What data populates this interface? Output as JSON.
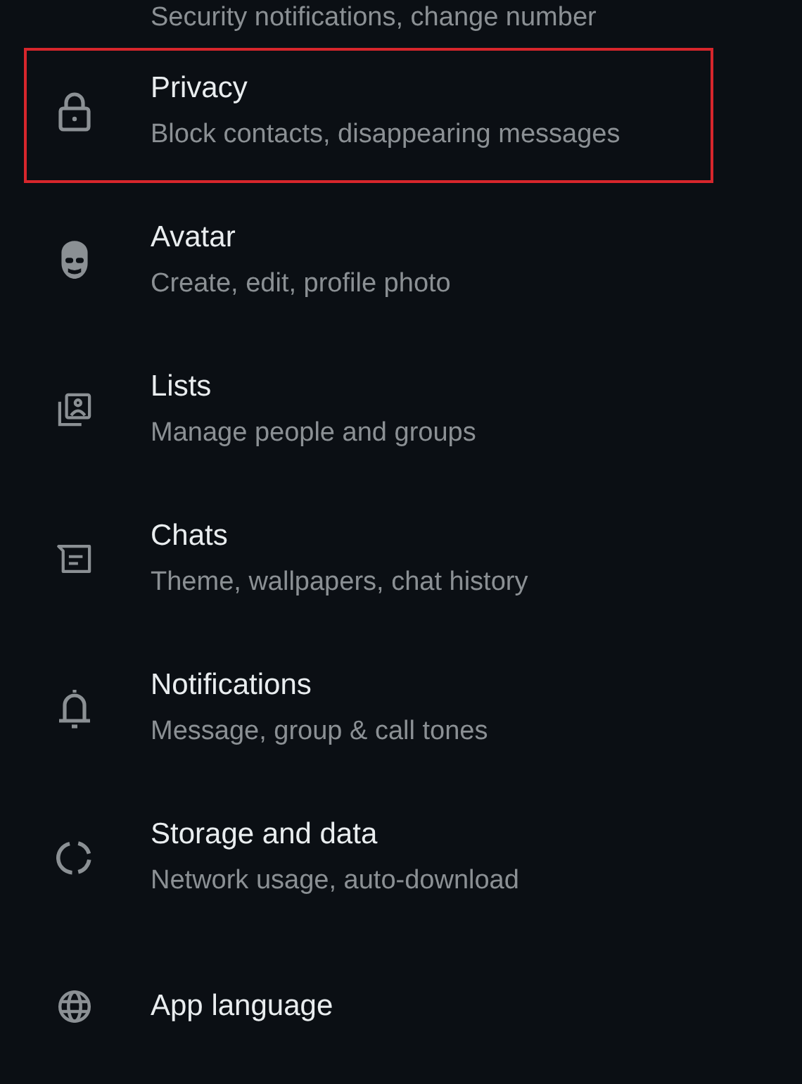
{
  "settings_items": [
    {
      "subtitle": "Security notifications, change number",
      "highlighted": false
    },
    {
      "title": "Privacy",
      "subtitle": "Block contacts, disappearing messages",
      "highlighted": true
    },
    {
      "title": "Avatar",
      "subtitle": "Create, edit, profile photo",
      "highlighted": false
    },
    {
      "title": "Lists",
      "subtitle": "Manage people and groups",
      "highlighted": false
    },
    {
      "title": "Chats",
      "subtitle": "Theme, wallpapers, chat history",
      "highlighted": false
    },
    {
      "title": "Notifications",
      "subtitle": "Message, group & call tones",
      "highlighted": false
    },
    {
      "title": "Storage and data",
      "subtitle": "Network usage, auto-download",
      "highlighted": false
    },
    {
      "title": "App language",
      "highlighted": false
    }
  ]
}
